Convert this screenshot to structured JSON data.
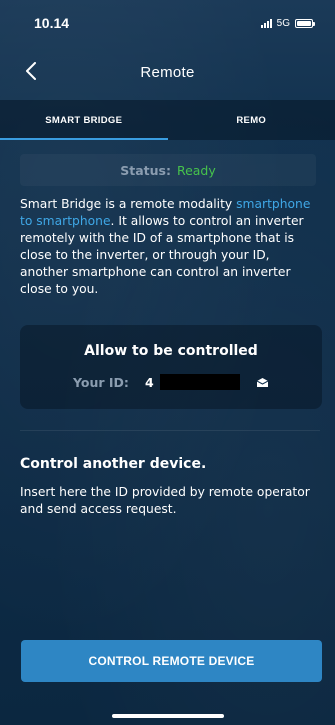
{
  "status_bar": {
    "time": "10.14",
    "network": "5G"
  },
  "nav": {
    "title": "Remote",
    "back_icon": "chevron-left-icon"
  },
  "tabs": [
    {
      "label": "SMART BRIDGE",
      "active": true
    },
    {
      "label": "REMO",
      "active": false
    }
  ],
  "status": {
    "label": "Status:",
    "value": "Ready",
    "value_color": "#46c24c"
  },
  "description": {
    "intro": "Smart Bridge is a remote modality ",
    "link": "smartphone to smartphone",
    "rest": ". It allows to control an inverter remotely with the ID of a smartphone that is close to the inverter, or through your ID, another smartphone can control an inverter close to you."
  },
  "allow": {
    "title": "Allow to be controlled",
    "id_label": "Your ID:",
    "id_value": "4",
    "share_icon": "envelope-icon"
  },
  "control": {
    "title": "Control another device.",
    "description": "Insert here the ID provided by remote operator and send access request.",
    "button_label": "CONTROL REMOTE DEVICE"
  },
  "colors": {
    "accent": "#3a9de0",
    "button": "#2e86c4",
    "link": "#3fa7e6",
    "status_ready": "#46c24c"
  }
}
